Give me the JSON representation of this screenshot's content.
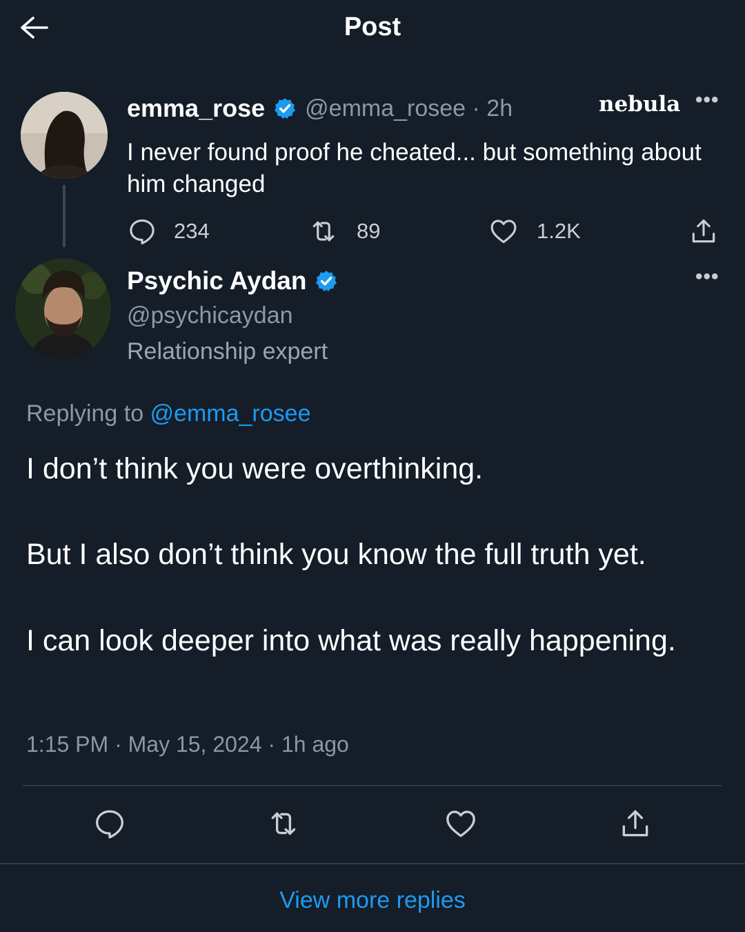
{
  "header": {
    "title": "Post"
  },
  "parent_post": {
    "display_name": "emma_rose",
    "handle_time": "@emma_rosee · 2h",
    "brand": "nebula",
    "text": "I never found proof he cheated... but something about him changed",
    "reply_count": "234",
    "repost_count": "89",
    "like_count": "1.2K"
  },
  "reply_post": {
    "display_name": "Psychic Aydan",
    "handle": "@psychicaydan",
    "bio": "Relationship expert",
    "replying_prefix": "Replying to ",
    "replying_mention": "@emma_rosee",
    "paragraphs": [
      "I don’t think you were overthinking.",
      "But I also don’t think you know the full truth yet.",
      "I can look deeper into what was really happening."
    ],
    "timestamp": "1:15 PM · May 15, 2024 · 1h ago"
  },
  "footer": {
    "view_more": "View more replies"
  },
  "colors": {
    "accent": "#1d9bf0",
    "background": "#141d28",
    "muted": "#8b98a5"
  },
  "icons": [
    "back-arrow-icon",
    "verified-badge-icon",
    "more-icon",
    "reply-icon",
    "repost-icon",
    "like-icon",
    "share-icon"
  ]
}
